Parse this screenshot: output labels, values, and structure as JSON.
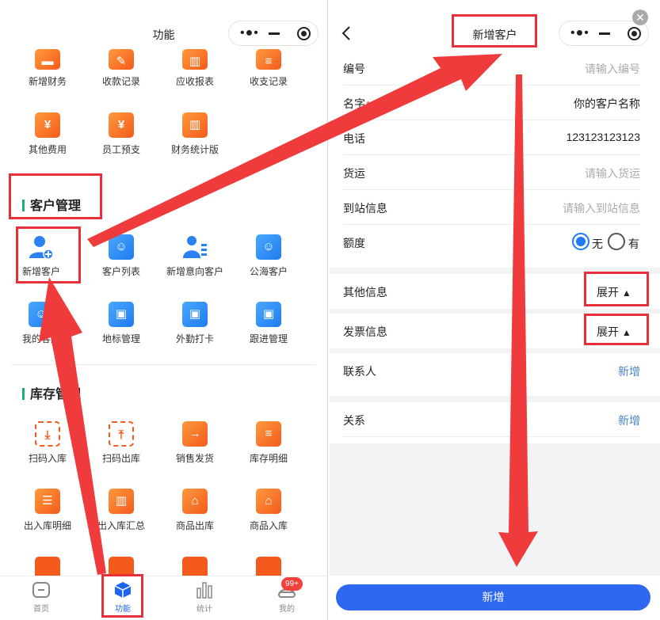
{
  "left_screen": {
    "header_title": "功能",
    "finance_items": [
      {
        "label": "新增财务",
        "icon": "wallet-icon"
      },
      {
        "label": "收款记录",
        "icon": "edit-record-icon"
      },
      {
        "label": "应收报表",
        "icon": "report-icon"
      },
      {
        "label": "收支记录",
        "icon": "receipt-icon"
      },
      {
        "label": "其他费用",
        "icon": "yen-icon"
      },
      {
        "label": "员工预支",
        "icon": "advance-icon"
      },
      {
        "label": "财务统计版",
        "icon": "statistics-icon"
      }
    ],
    "customer_section_title": "客户管理",
    "customer_items": [
      {
        "label": "新增客户",
        "icon": "add-user-icon"
      },
      {
        "label": "客户列表",
        "icon": "contact-card-icon"
      },
      {
        "label": "新增意向客户",
        "icon": "prospect-icon"
      },
      {
        "label": "公海客户",
        "icon": "contact-card-icon"
      },
      {
        "label": "我的客户",
        "icon": "contact-card-icon"
      },
      {
        "label": "地标管理",
        "icon": "briefcase-icon"
      },
      {
        "label": "外勤打卡",
        "icon": "briefcase-icon"
      },
      {
        "label": "跟进管理",
        "icon": "briefcase-icon"
      }
    ],
    "inventory_section_title": "库存管理",
    "inventory_items": [
      {
        "label": "扫码入库",
        "icon": "scan-in-icon"
      },
      {
        "label": "扫码出库",
        "icon": "scan-out-icon"
      },
      {
        "label": "销售发货",
        "icon": "shipping-icon"
      },
      {
        "label": "库存明细",
        "icon": "document-icon"
      },
      {
        "label": "出入库明细",
        "icon": "list-icon"
      },
      {
        "label": "出入库汇总",
        "icon": "chart-icon"
      },
      {
        "label": "商品出库",
        "icon": "warehouse-out-icon"
      },
      {
        "label": "商品入库",
        "icon": "warehouse-in-icon"
      }
    ],
    "tabbar": [
      {
        "label": "首页",
        "icon": "home-icon"
      },
      {
        "label": "功能",
        "icon": "cube-icon"
      },
      {
        "label": "统计",
        "icon": "bar-chart-icon"
      },
      {
        "label": "我的",
        "icon": "profile-icon"
      }
    ],
    "badge": "99+"
  },
  "right_screen": {
    "header_title": "新增客户",
    "form": {
      "number_label": "编号",
      "number_placeholder": "请输入编号",
      "name_label": "名字",
      "name_required": "*",
      "name_value": "你的客户名称",
      "phone_label": "电话",
      "phone_value": "123123123123",
      "freight_label": "货运",
      "freight_placeholder": "请输入货运",
      "arrival_label": "到站信息",
      "arrival_placeholder": "请输入到站信息",
      "quota_label": "额度",
      "quota_option_none": "无",
      "quota_option_yes": "有",
      "quota_selected": "无",
      "other_info_label": "其他信息",
      "other_info_action": "展开",
      "invoice_label": "发票信息",
      "invoice_action": "展开",
      "contact_label": "联系人",
      "contact_action": "新增",
      "relation_label": "关系",
      "relation_action": "新增"
    },
    "submit_label": "新增"
  },
  "colors": {
    "accent_blue": "#2f68f0",
    "annotation_red": "#e8303b",
    "section_green": "#1aad74",
    "icon_orange": "#f35a1c"
  }
}
